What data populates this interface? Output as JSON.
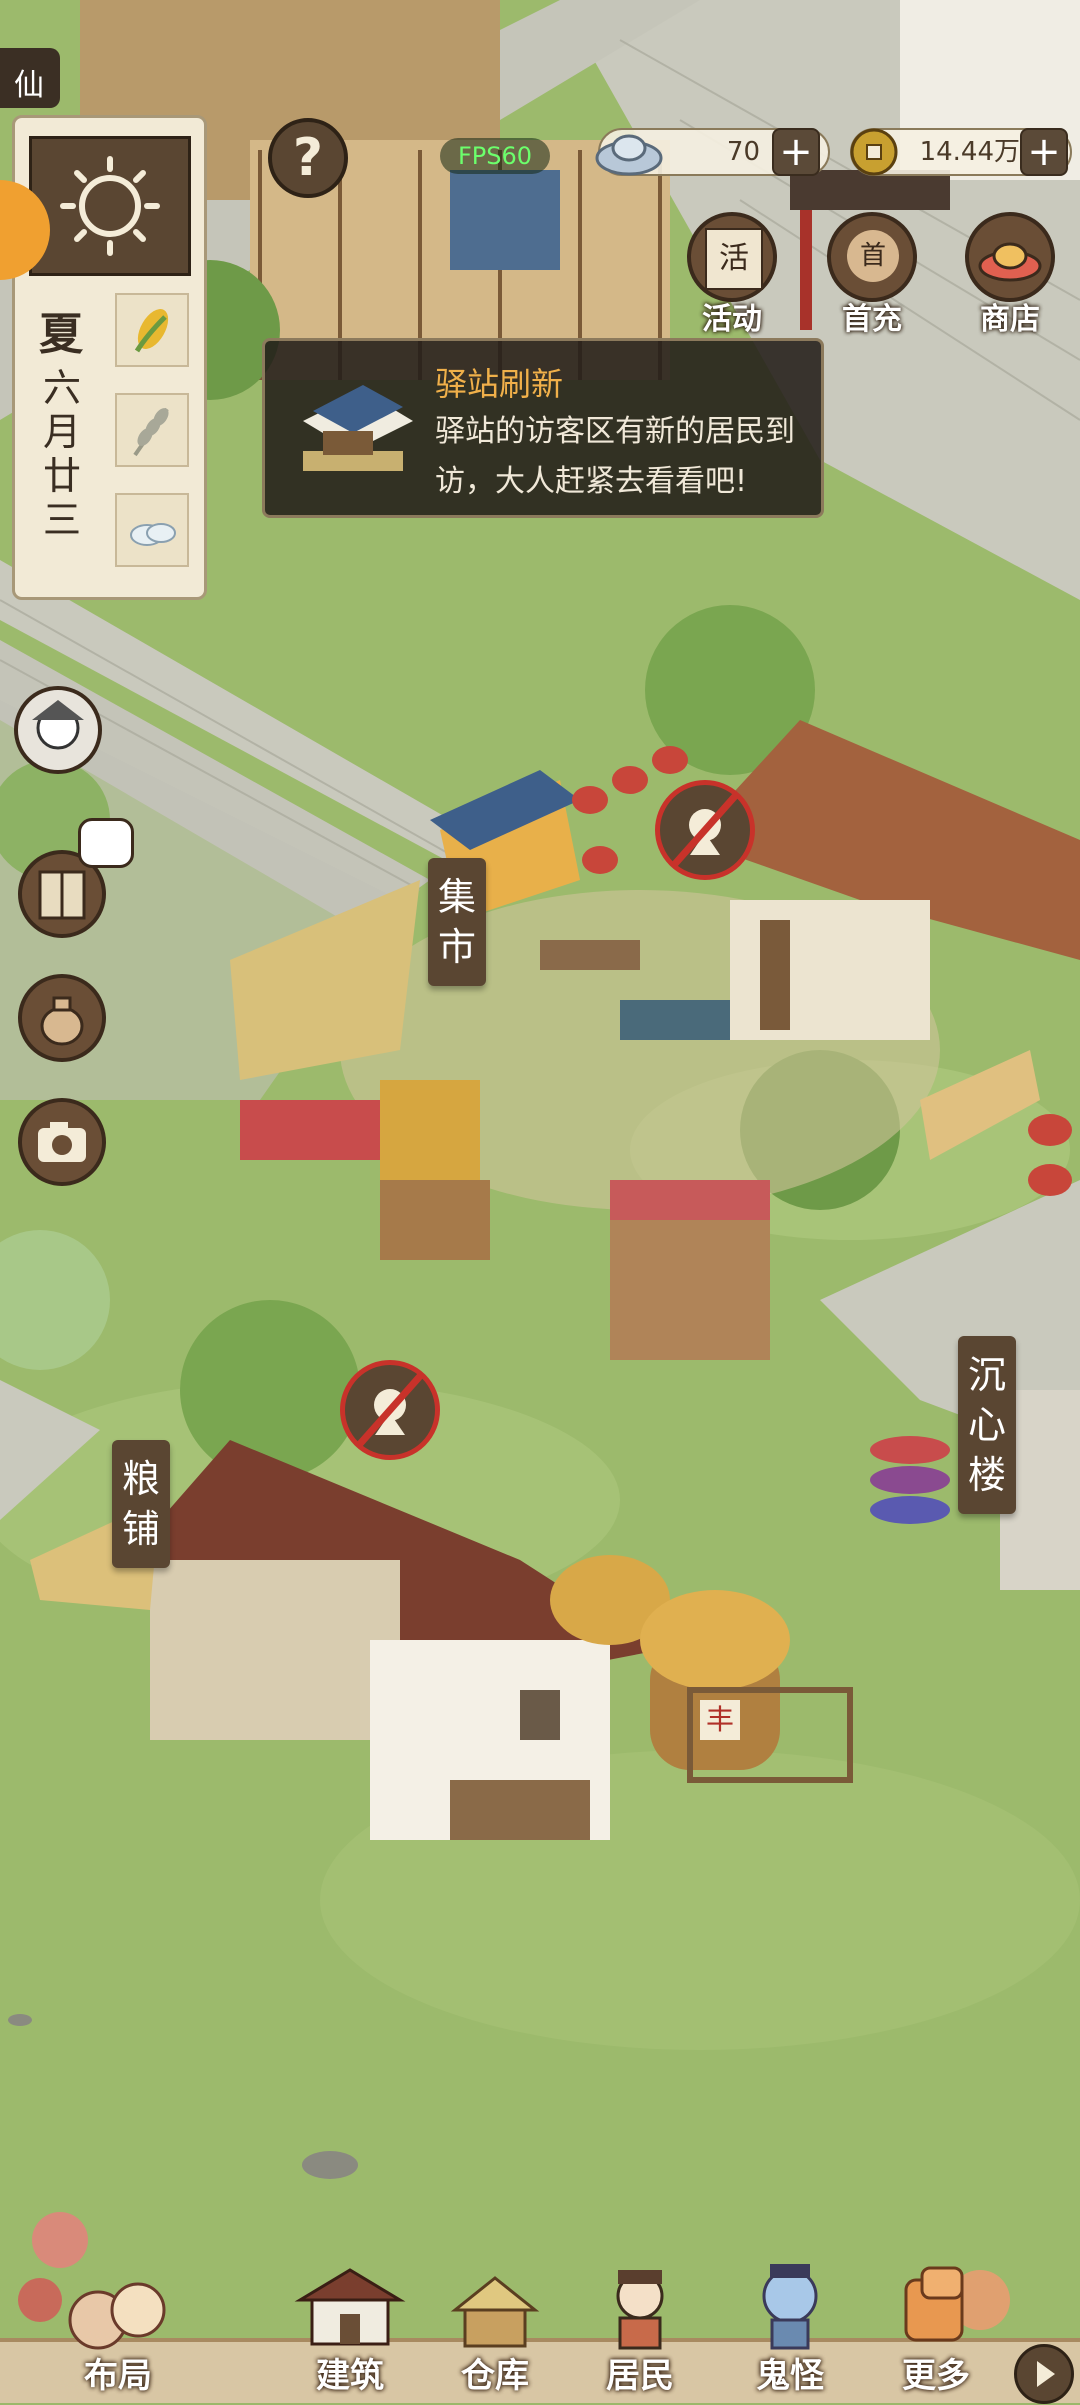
{
  "top_bar": {
    "fps": "FPS60",
    "silver_value": "70",
    "coin_value": "14.44万",
    "plus": "+"
  },
  "top_buttons": [
    {
      "label": "活动",
      "icon": "activity-scroll-icon",
      "glyph": "活"
    },
    {
      "label": "首充",
      "icon": "first-charge-bag-icon",
      "glyph": "首"
    },
    {
      "label": "商店",
      "icon": "shop-ingot-icon",
      "glyph": ""
    }
  ],
  "help_glyph": "?",
  "left_edge_tag": "仙",
  "calendar": {
    "season": "夏",
    "date": "六月廿三",
    "weather": "sun-icon"
  },
  "notification": {
    "title": "驿站刷新",
    "message": "驿站的访客区有新的居民到访，大人赶紧去看看吧!"
  },
  "buildings": {
    "market": "集市",
    "grain_shop": "粮铺",
    "tower": "沉心楼"
  },
  "grain_sign": "丰",
  "bottom_nav": [
    {
      "label": "布局",
      "icon": "layout-icon"
    },
    {
      "label": "建筑",
      "icon": "building-icon"
    },
    {
      "label": "仓库",
      "icon": "warehouse-icon"
    },
    {
      "label": "居民",
      "icon": "resident-icon"
    },
    {
      "label": "鬼怪",
      "icon": "ghost-icon"
    },
    {
      "label": "更多",
      "icon": "more-icon"
    }
  ]
}
